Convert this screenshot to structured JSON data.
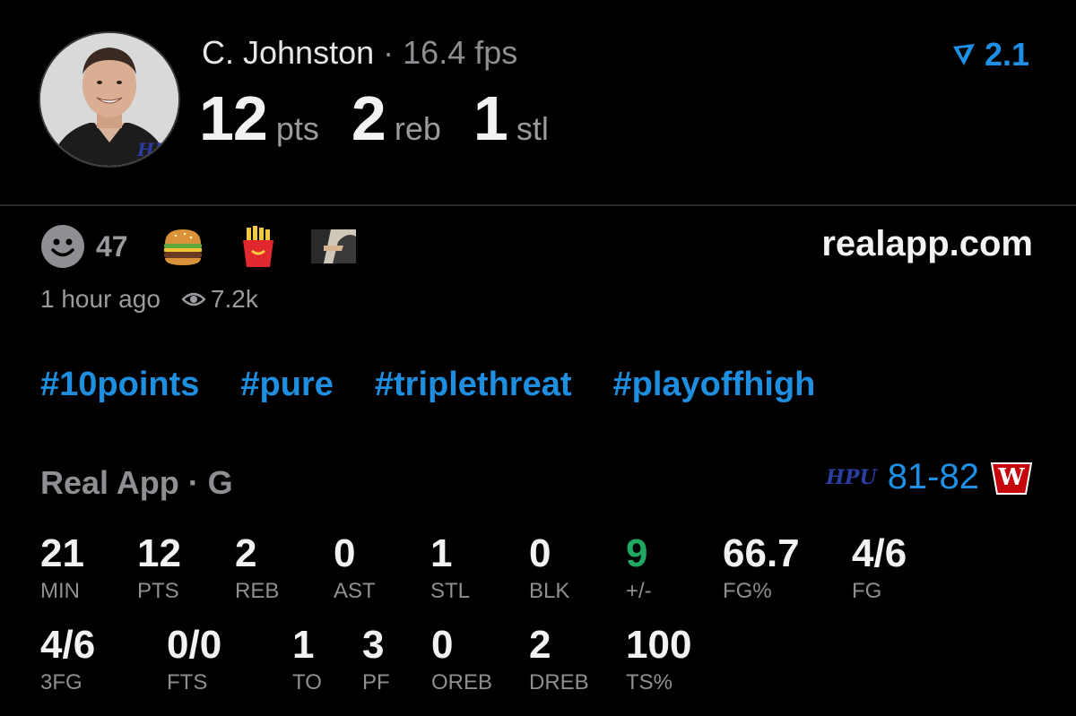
{
  "header": {
    "player_name": "C. Johnston",
    "separator": "·",
    "fps": "16.4 fps",
    "stats": [
      {
        "num": "12",
        "unit": "pts"
      },
      {
        "num": "2",
        "unit": "reb"
      },
      {
        "num": "1",
        "unit": "stl"
      }
    ],
    "rating": "2.1",
    "avatar_badge": "HPU"
  },
  "reactions": {
    "smile_count": "47",
    "icons": [
      "smiley-icon",
      "burger-icon",
      "fries-icon",
      "thumbnail-image"
    ]
  },
  "site": "realapp.com",
  "meta": {
    "time": "1 hour ago",
    "views": "7.2k"
  },
  "tags": [
    "#10points",
    "#pure",
    "#triplethreat",
    "#playoffhigh"
  ],
  "game": {
    "label": "Real App · G",
    "score": "81-82",
    "home_badge": "HPU",
    "away_badge": "W"
  },
  "stats_row1": [
    {
      "v": "21",
      "l": "MIN"
    },
    {
      "v": "12",
      "l": "PTS"
    },
    {
      "v": "2",
      "l": "REB"
    },
    {
      "v": "0",
      "l": "AST"
    },
    {
      "v": "1",
      "l": "STL"
    },
    {
      "v": "0",
      "l": "BLK"
    },
    {
      "v": "9",
      "l": "+/-"
    },
    {
      "v": "66.7",
      "l": "FG%"
    },
    {
      "v": "4/6",
      "l": "FG"
    }
  ],
  "stats_row2": [
    {
      "v": "4/6",
      "l": "3FG"
    },
    {
      "v": "0/0",
      "l": "FTS"
    },
    {
      "v": "1",
      "l": "TO"
    },
    {
      "v": "3",
      "l": "PF"
    },
    {
      "v": "0",
      "l": "OREB"
    },
    {
      "v": "2",
      "l": "DREB"
    },
    {
      "v": "100",
      "l": "TS%"
    }
  ],
  "colors": {
    "accent_blue": "#1e90e6",
    "positive_green": "#1ea862",
    "muted": "#8e8e93",
    "wisconsin_red": "#c5050c"
  }
}
